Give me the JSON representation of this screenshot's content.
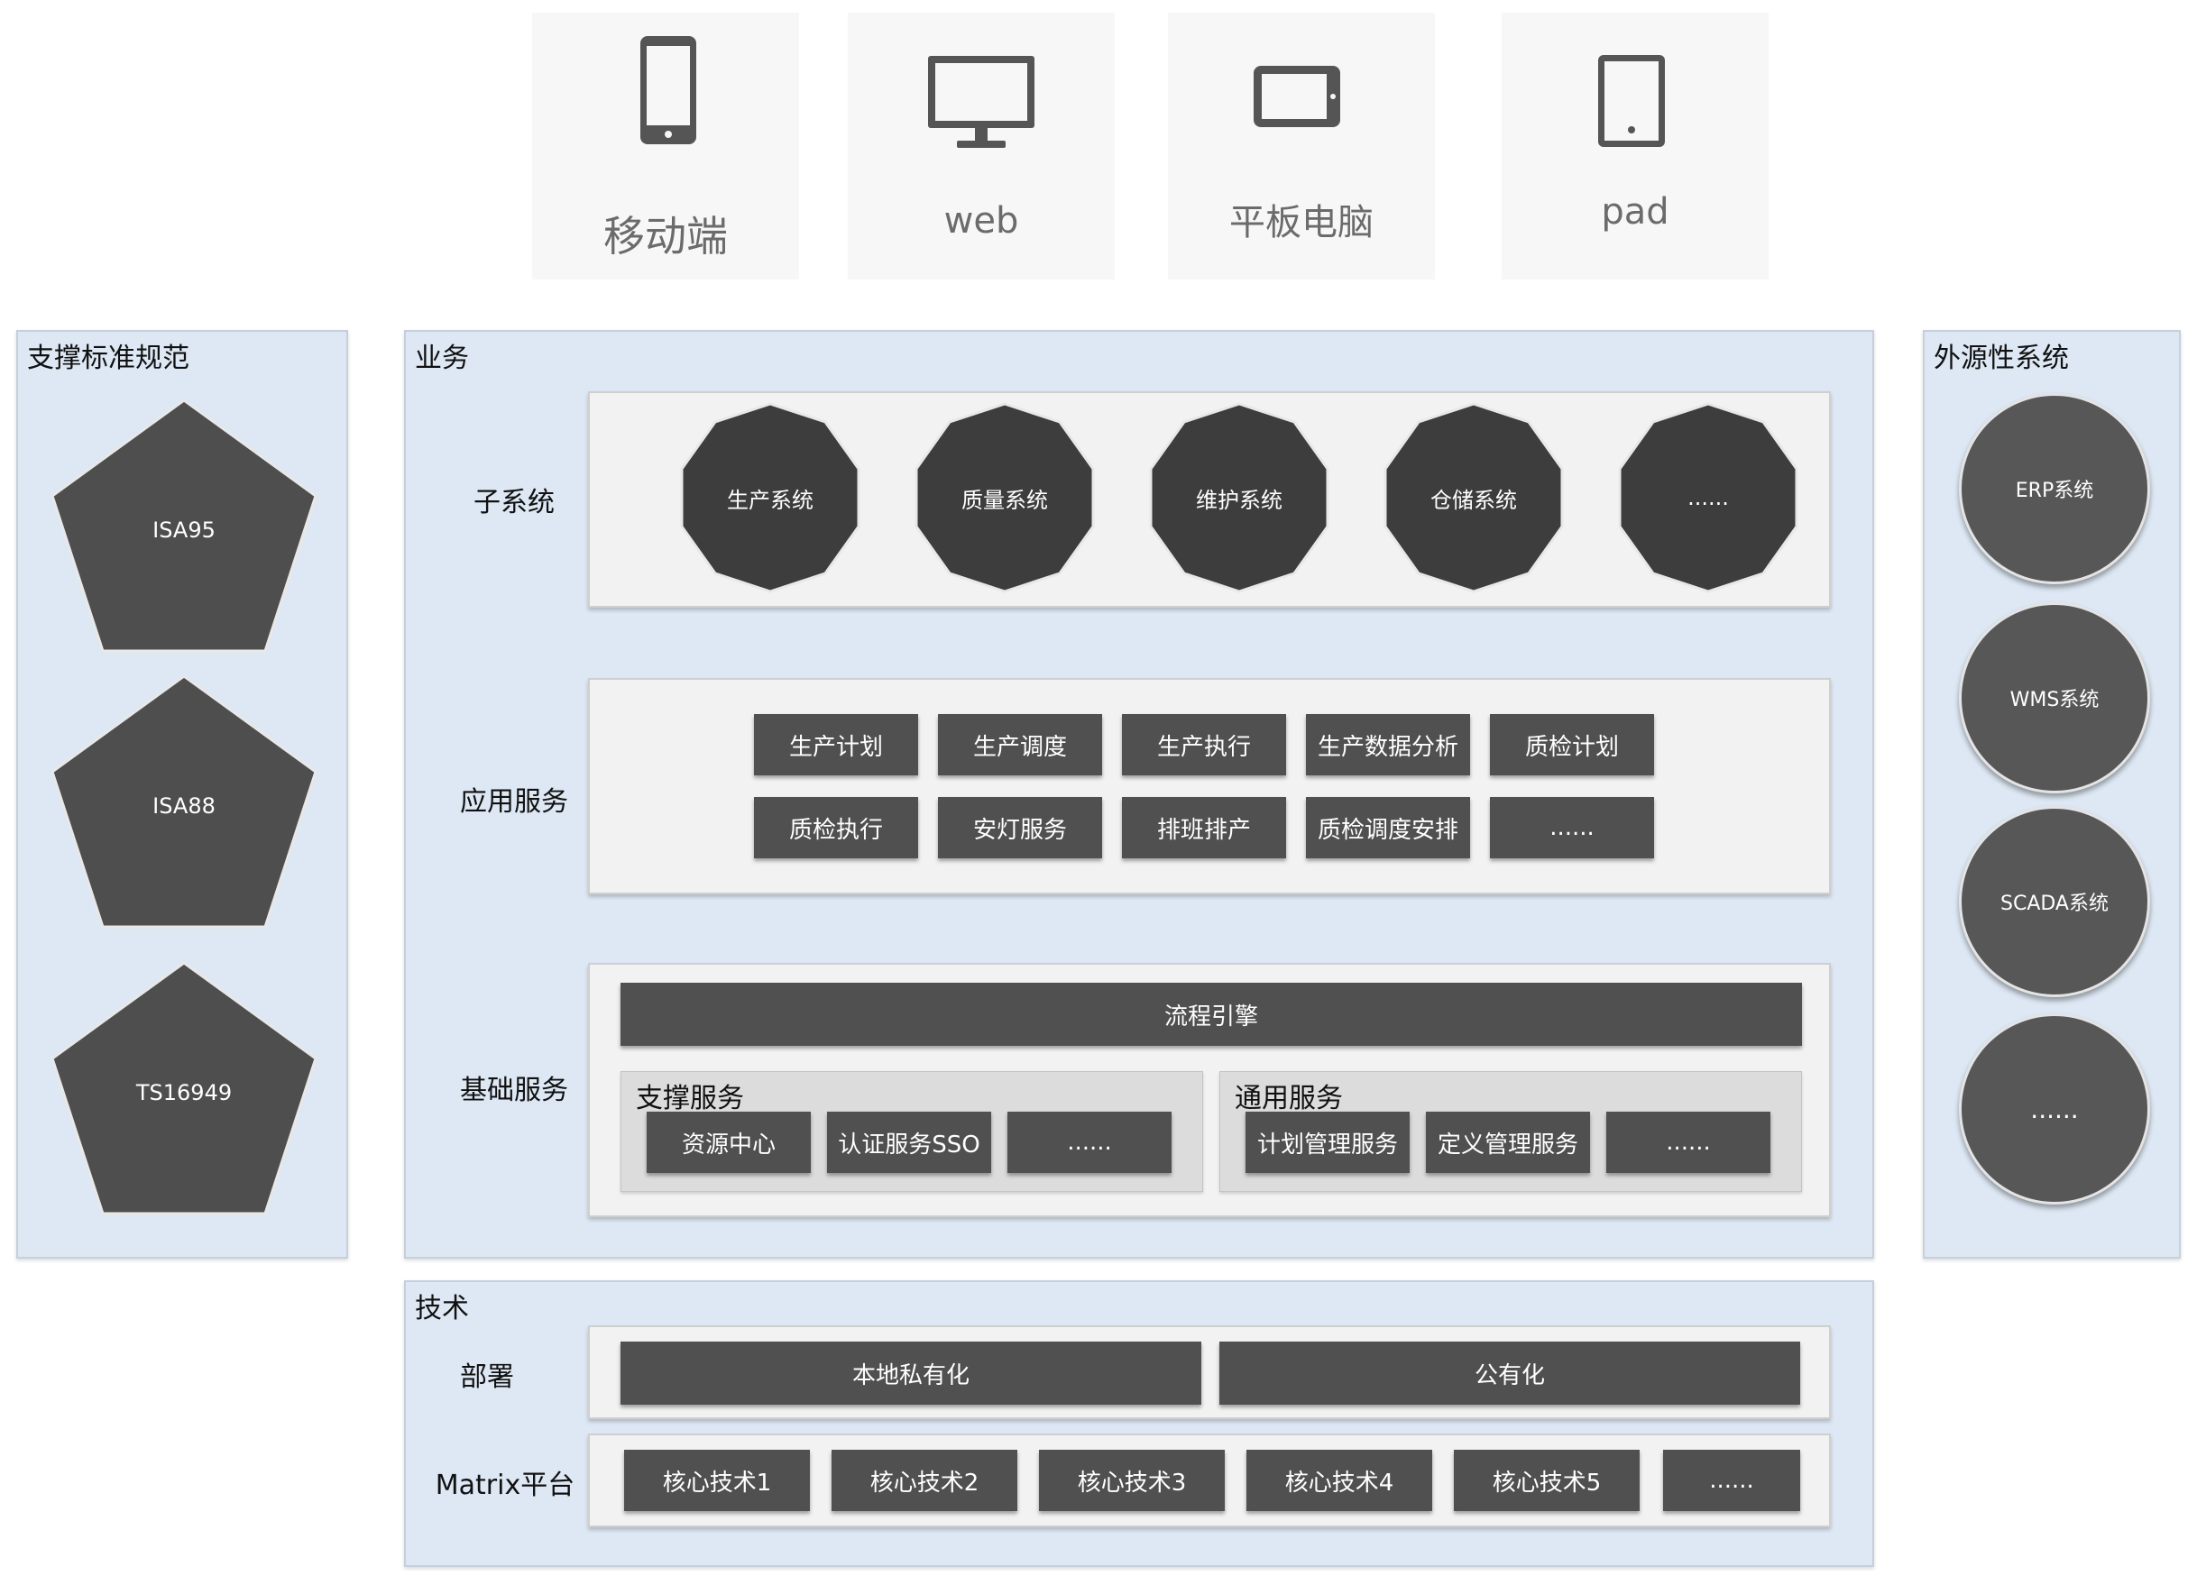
{
  "devices": [
    {
      "label": "移动端",
      "icon": "mobile-phone-icon"
    },
    {
      "label": "web",
      "icon": "desktop-monitor-icon"
    },
    {
      "label": "平板电脑",
      "icon": "tablet-landscape-icon"
    },
    {
      "label": "pad",
      "icon": "tablet-portrait-icon"
    }
  ],
  "standards": {
    "title": "支撑标准规范",
    "items": [
      "ISA95",
      "ISA88",
      "TS16949"
    ]
  },
  "business": {
    "title": "业务",
    "subsystems": {
      "label": "子系统",
      "items": [
        "生产系统",
        "质量系统",
        "维护系统",
        "仓储系统",
        "......"
      ]
    },
    "app_services": {
      "label": "应用服务",
      "row1": [
        "生产计划",
        "生产调度",
        "生产执行",
        "生产数据分析",
        "质检计划"
      ],
      "row2": [
        "质检执行",
        "安灯服务",
        "排班排产",
        "质检调度安排",
        "......"
      ]
    },
    "base_services": {
      "label": "基础服务",
      "engine": "流程引擎",
      "support": {
        "title": "支撑服务",
        "items": [
          "资源中心",
          "认证服务SSO",
          "......"
        ]
      },
      "common": {
        "title": "通用服务",
        "items": [
          "计划管理服务",
          "定义管理服务",
          "......"
        ]
      }
    }
  },
  "external": {
    "title": "外源性系统",
    "items": [
      "ERP系统",
      "WMS系统",
      "SCADA系统",
      "......"
    ]
  },
  "tech": {
    "title": "技术",
    "deploy": {
      "label": "部署",
      "items": [
        "本地私有化",
        "公有化"
      ]
    },
    "matrix": {
      "label": "Matrix平台",
      "items": [
        "核心技术1",
        "核心技术2",
        "核心技术3",
        "核心技术4",
        "核心技术5",
        "......"
      ]
    }
  },
  "colors": {
    "panel_bg": "#dde8f4",
    "box_dark": "#505050",
    "shape_dark": "#404040",
    "device_icon": "#555555"
  }
}
